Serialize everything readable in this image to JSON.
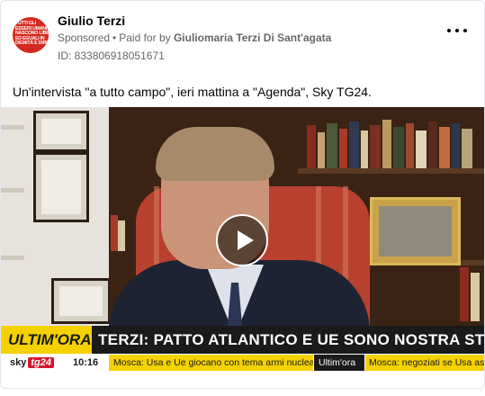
{
  "post": {
    "author": "Giulio Terzi",
    "sponsored": "Sponsored",
    "paid_for_prefix": "Paid for by",
    "payer": "Giuliomaria Terzi Di Sant'agata",
    "ad_id": "ID: 833806918051671",
    "caption": "Un'intervista \"a tutto campo\", ieri mattina a \"Agenda\", Sky TG24.",
    "avatar_text": "TUTTI GLI\nESSERI UMANI\nNASCONO LIBERI\nED EGUALI IN\nDIGNITÀ E DIRITTI"
  },
  "video": {
    "ultim_ora": "ULTIM'ORA",
    "headline": "TERZI: PATTO ATLANTICO E UE SONO NOSTRA STELLA POLARE",
    "channel_sky": "sky",
    "channel_tg": "tg24",
    "time": "10:16",
    "ticker_1": "Mosca: Usa e Ue giocano con tema armi nucleari",
    "ticker_2": "Ultim'ora",
    "ticker_3": "Mosca: negoziati se Usa ascoltano",
    "play_icon": "play-icon"
  },
  "colors": {
    "sky_yellow": "#f4d100",
    "sky_red": "#d4162e",
    "avatar_red": "#d42a1e"
  }
}
